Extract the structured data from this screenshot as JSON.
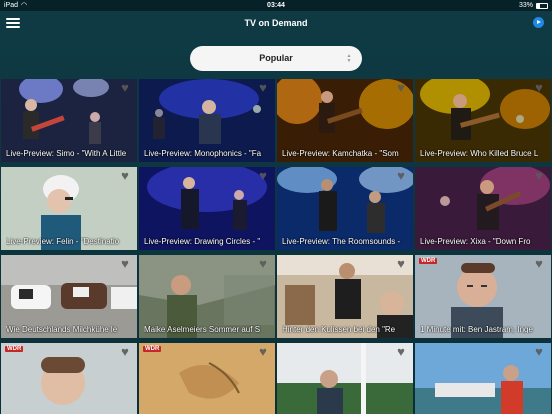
{
  "statusbar": {
    "carrier": "iPad",
    "time": "03:44",
    "battery": "33%"
  },
  "navbar": {
    "title": "TV on Demand"
  },
  "filter": {
    "selected": "Popular"
  },
  "tiles": [
    {
      "caption": "Live-Preview: Simo - \"With A Little",
      "badge": "",
      "heart": "♥"
    },
    {
      "caption": "Live-Preview: Monophonics - \"Fa",
      "badge": "",
      "heart": "♥"
    },
    {
      "caption": "Live-Preview: Kamchatka - \"Som",
      "badge": "",
      "heart": "♥"
    },
    {
      "caption": "Live-Preview: Who Killed Bruce L",
      "badge": "",
      "heart": "♥"
    },
    {
      "caption": "Live-Preview: Felin - \"Destinatio",
      "badge": "",
      "heart": "♥"
    },
    {
      "caption": "Live-Preview: Drawing Circles - \"",
      "badge": "",
      "heart": "♥"
    },
    {
      "caption": "Live-Preview: The Roomsounds -",
      "badge": "",
      "heart": "♥"
    },
    {
      "caption": "Live-Preview: Xixa - \"Down Fro",
      "badge": "",
      "heart": "♥"
    },
    {
      "caption": "Wie Deutschlands Milchkühe le",
      "badge": "",
      "heart": "♥"
    },
    {
      "caption": "Maike Aselmeiers Sommer auf S",
      "badge": "",
      "heart": "♥"
    },
    {
      "caption": "Hinter den Kulissen bei den \"Re",
      "badge": "",
      "heart": "♥"
    },
    {
      "caption": "1 Minute mit: Ben Jastram, Inge",
      "badge": "WDR",
      "heart": "♥"
    },
    {
      "caption": "",
      "badge": "WDR",
      "heart": "♥"
    },
    {
      "caption": "",
      "badge": "WDR",
      "heart": "♥"
    },
    {
      "caption": "",
      "badge": "",
      "heart": "♥"
    },
    {
      "caption": "",
      "badge": "",
      "heart": "♥"
    }
  ],
  "colors": {
    "background": "#0f3b45",
    "accent": "#1e88e5"
  }
}
